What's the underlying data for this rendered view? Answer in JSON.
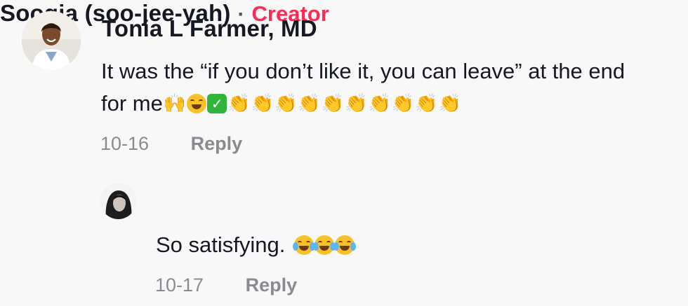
{
  "comment": {
    "username": "Tonia L Farmer, MD",
    "text_line1": "It was the “if you don’t like it, you can leave” at the end",
    "text_line2": "for me",
    "emojis": [
      "raising-hands",
      "rofl",
      "check-mark",
      "clap",
      "clap",
      "clap",
      "clap",
      "clap",
      "clap",
      "clap",
      "clap",
      "clap",
      "clap"
    ],
    "date": "10-16",
    "reply_label": "Reply"
  },
  "reply": {
    "username": "Soogia (soo-jee-yah)",
    "separator": "·",
    "badge": "Creator",
    "text": "So satisfying.",
    "emojis": [
      "tears-of-joy",
      "tears-of-joy",
      "tears-of-joy"
    ],
    "date": "10-17",
    "reply_label": "Reply"
  },
  "colors": {
    "background": "#f8f8f8",
    "text": "#161823",
    "meta": "#8a8b91",
    "creator_badge": "#fe2c55"
  }
}
